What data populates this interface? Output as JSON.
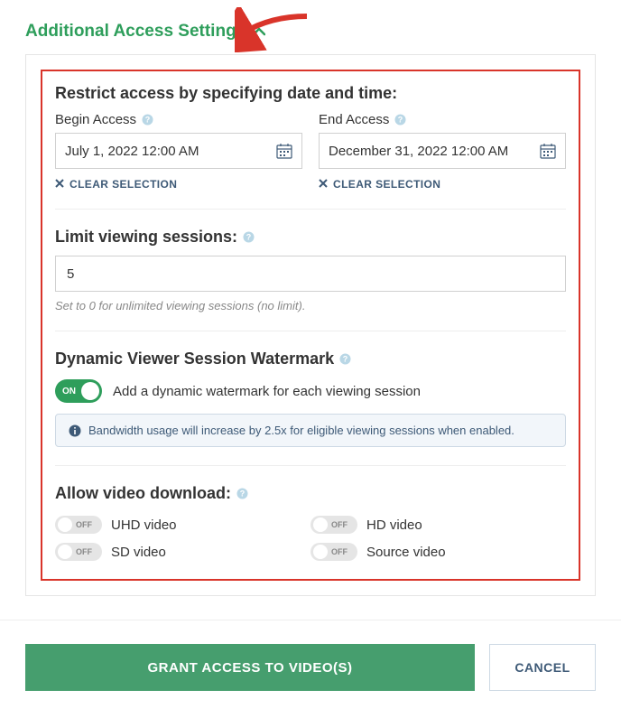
{
  "header": {
    "title": "Additional Access Settings"
  },
  "restrict": {
    "title": "Restrict access by specifying date and time:",
    "begin_label": "Begin Access",
    "end_label": "End Access",
    "begin_value": "July 1, 2022 12:00 AM",
    "end_value": "December 31, 2022 12:00 AM",
    "clear": "CLEAR SELECTION"
  },
  "sessions": {
    "label": "Limit viewing sessions:",
    "value": "5",
    "hint": "Set to 0 for unlimited viewing sessions (no limit)."
  },
  "watermark": {
    "title": "Dynamic Viewer Session Watermark",
    "toggle_text": "ON",
    "description": "Add a dynamic watermark for each viewing session",
    "banner": "Bandwidth usage will increase by 2.5x for eligible viewing sessions when enabled."
  },
  "download": {
    "title": "Allow video download:",
    "toggle_text": "OFF",
    "items": [
      "UHD video",
      "HD video",
      "SD video",
      "Source video"
    ]
  },
  "footer": {
    "primary": "GRANT ACCESS TO VIDEO(S)",
    "secondary": "CANCEL"
  }
}
